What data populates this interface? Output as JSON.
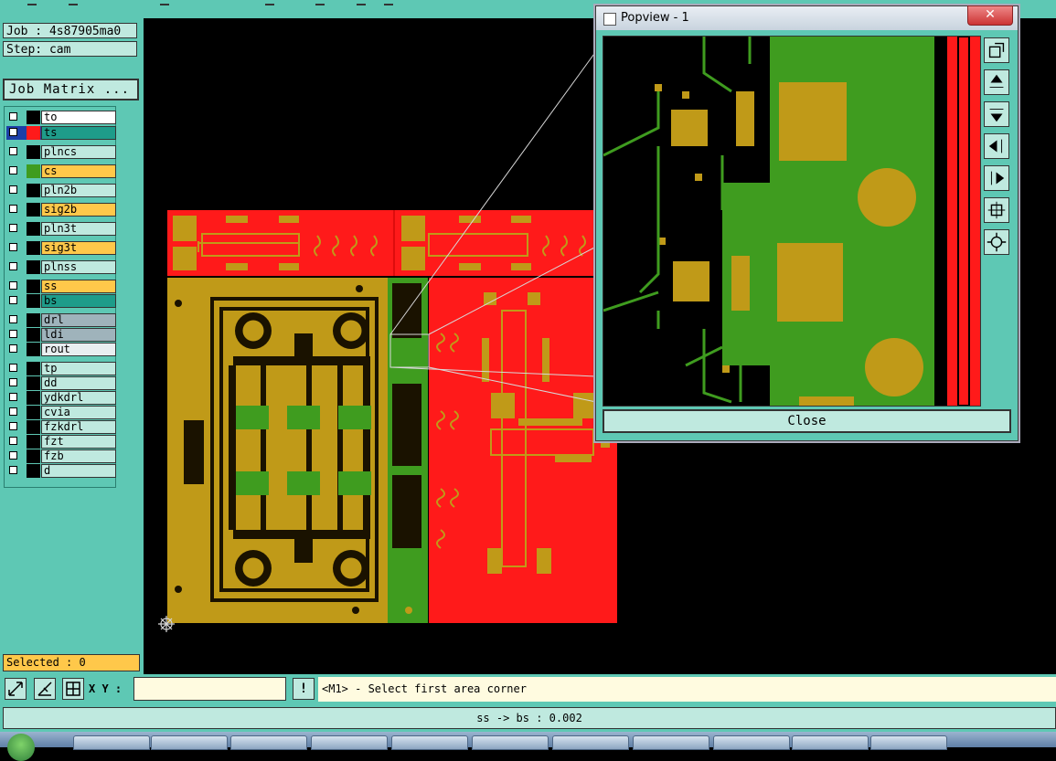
{
  "colors": {
    "panel": "#5ec8b4",
    "field": "#bfe9df",
    "red": "#ff1a1a",
    "copper": "#c09a18",
    "green": "#3f9c1f",
    "orange_layer": "#ffc84a",
    "teal_layer": "#1e9c8a",
    "gray_layer": "#9fb3bb"
  },
  "info": {
    "job": "Job : 4s87905ma0",
    "step": "Step: cam",
    "job_matrix": "Job Matrix ..."
  },
  "layers": [
    {
      "name": "to",
      "swatch": "#000000",
      "bg": "#ffffff",
      "group": 1
    },
    {
      "name": "ts",
      "swatch": "#ff1a1a",
      "bg": "#1e9c8a",
      "group": 1,
      "active": true
    },
    {
      "name": "plncs",
      "swatch": "#000000",
      "bg": "#bfe9df",
      "group": 2
    },
    {
      "name": "cs",
      "swatch": "#3f9c1f",
      "bg": "#ffc84a",
      "group": 2
    },
    {
      "name": "pln2b",
      "swatch": "#000000",
      "bg": "#bfe9df",
      "group": 2
    },
    {
      "name": "sig2b",
      "swatch": "#000000",
      "bg": "#ffc84a",
      "group": 2
    },
    {
      "name": "pln3t",
      "swatch": "#000000",
      "bg": "#bfe9df",
      "group": 2
    },
    {
      "name": "sig3t",
      "swatch": "#000000",
      "bg": "#ffc84a",
      "group": 2
    },
    {
      "name": "plnss",
      "swatch": "#000000",
      "bg": "#bfe9df",
      "group": 2
    },
    {
      "name": "ss",
      "swatch": "#000000",
      "bg": "#ffc84a",
      "group": 3
    },
    {
      "name": "bs",
      "swatch": "#000000",
      "bg": "#1e9c8a",
      "group": 3
    },
    {
      "name": "drl",
      "swatch": "#000000",
      "bg": "#9fb3bb",
      "group": 4
    },
    {
      "name": "ldi",
      "swatch": "#000000",
      "bg": "#9fb3bb",
      "group": 4
    },
    {
      "name": "rout",
      "swatch": "#000000",
      "bg": "#e8eef0",
      "group": 4
    },
    {
      "name": "tp",
      "swatch": "#000000",
      "bg": "#bfe9df",
      "group": 5
    },
    {
      "name": "dd",
      "swatch": "#000000",
      "bg": "#bfe9df",
      "group": 5
    },
    {
      "name": "ydkdrl",
      "swatch": "#000000",
      "bg": "#bfe9df",
      "group": 5
    },
    {
      "name": "cvia",
      "swatch": "#000000",
      "bg": "#bfe9df",
      "group": 5
    },
    {
      "name": "fzkdrl",
      "swatch": "#000000",
      "bg": "#bfe9df",
      "group": 5
    },
    {
      "name": "fzt",
      "swatch": "#000000",
      "bg": "#bfe9df",
      "group": 5
    },
    {
      "name": "fzb",
      "swatch": "#000000",
      "bg": "#bfe9df",
      "group": 5
    },
    {
      "name": "d",
      "swatch": "#000000",
      "bg": "#bfe9df",
      "group": 5
    }
  ],
  "selected": "Selected : 0",
  "popup": {
    "title": "Popview - 1",
    "close_x": "✕",
    "close_button": "Close",
    "side_icons": [
      "popout-icon",
      "move-up-icon",
      "move-down-icon",
      "move-left-icon",
      "move-right-icon",
      "zoom-fit-icon",
      "pan-icon"
    ]
  },
  "command_bar": {
    "xy_label": "X Y :",
    "xy_value": "",
    "exclaim": "!",
    "prompt": "<M1> - Select first area corner"
  },
  "status": {
    "text": "ss -> bs : 0.002"
  },
  "taskbar": {
    "items": 11
  }
}
